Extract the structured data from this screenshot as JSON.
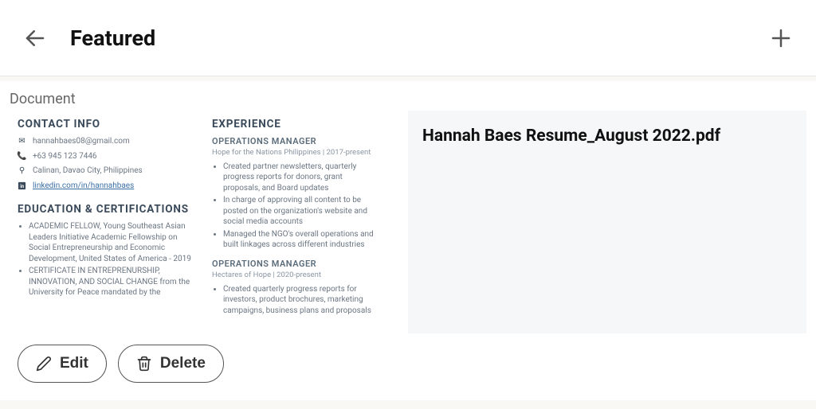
{
  "header": {
    "title": "Featured"
  },
  "document": {
    "label": "Document",
    "file_title": "Hannah Baes Resume_August 2022.pdf",
    "preview": {
      "contact_heading": "CONTACT INFO",
      "email": "hannahbaes08@gmail.com",
      "phone": "+63 945 123 7446",
      "address": "Calinan, Davao City, Philippines",
      "linkedin": "linkedin.com/in/hannahbaes",
      "education_heading": "EDUCATION & CERTIFICATIONS",
      "edu_items": [
        "ACADEMIC FELLOW, Young Southeast Asian Leaders Initiative Academic Fellowship on Social Entrepreneurship and Economic Development, United States of America - 2019",
        "CERTIFICATE IN ENTREPRENURSHIP, INNOVATION, AND SOCIAL CHANGE from the University for Peace mandated by the"
      ],
      "experience_heading": "EXPERIENCE",
      "jobs": [
        {
          "title": "OPERATIONS MANAGER",
          "sub": "Hope for the Nations Philippines | 2017-present",
          "bullets": [
            "Created partner newsletters, quarterly progress reports for donors, grant proposals, and Board updates",
            "In charge of approving all content to be posted on  the organization's website and social media accounts",
            "Managed the NGO's  overall operations and built linkages across different industries"
          ]
        },
        {
          "title": "OPERATIONS MANAGER",
          "sub": "Hectares of Hope | 2020-present",
          "bullets": [
            "Created quarterly progress reports for investors, product brochures, marketing campaigns, business plans and proposals"
          ]
        }
      ]
    }
  },
  "actions": {
    "edit": "Edit",
    "delete": "Delete"
  }
}
